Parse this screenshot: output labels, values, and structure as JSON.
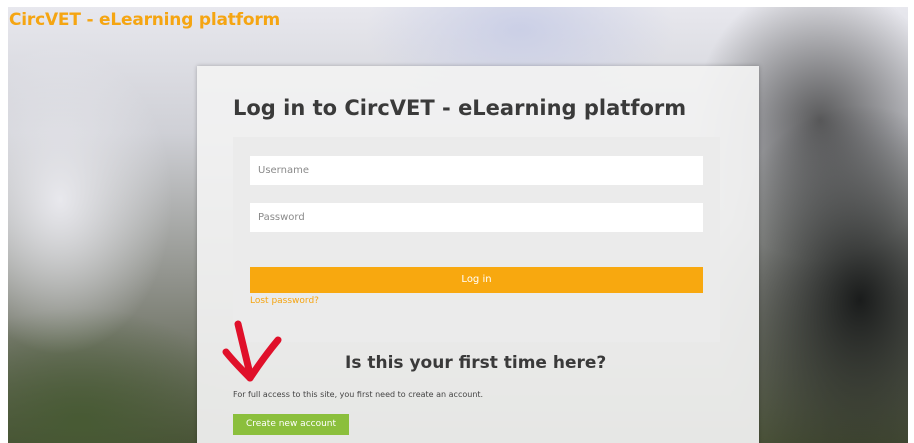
{
  "header": {
    "site_title": "CircVET - eLearning platform"
  },
  "login": {
    "title": "Log in to CircVET - eLearning platform",
    "username_placeholder": "Username",
    "password_placeholder": "Password",
    "login_button": "Log in",
    "lost_password": "Lost password?"
  },
  "signup": {
    "heading": "Is this your first time here?",
    "description": "For full access to this site, you first need to create an account.",
    "create_button": "Create new account"
  },
  "annotations": {
    "arrow_icon": "red-hand-drawn-arrow-icon"
  },
  "colors": {
    "accent": "#f8a80f",
    "create": "#8bbf3c",
    "arrow": "#e0102a"
  }
}
